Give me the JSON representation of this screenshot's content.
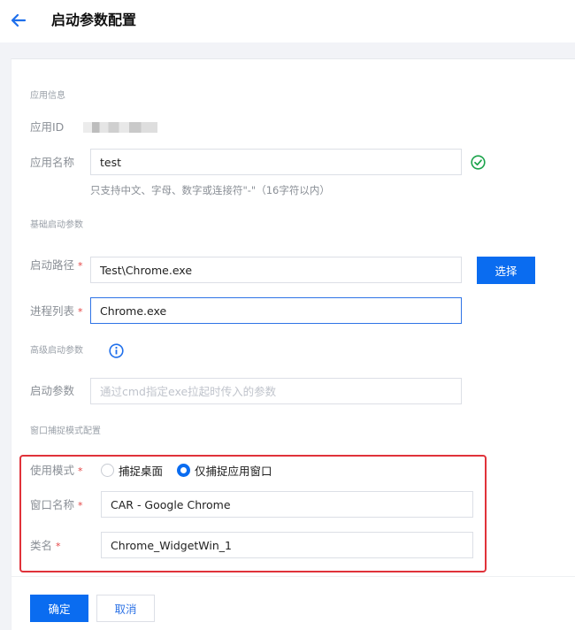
{
  "header": {
    "title": "启动参数配置",
    "back_icon": "arrow-left-icon"
  },
  "app_info": {
    "section_title": "应用信息",
    "app_id_label": "应用ID",
    "app_name_label": "应用名称",
    "app_name_value": "test",
    "app_name_hint": "只支持中文、字母、数字或连接符\"-\"（16字符以内）"
  },
  "basic": {
    "section_title": "基础启动参数",
    "path_label": "启动路径",
    "path_value": "Test\\Chrome.exe",
    "select_button": "选择",
    "process_label": "进程列表",
    "process_value": "Chrome.exe"
  },
  "advanced": {
    "section_title": "高级启动参数",
    "params_label": "启动参数",
    "params_placeholder": "通过cmd指定exe拉起时传入的参数"
  },
  "capture": {
    "section_title": "窗口捕捉模式配置",
    "mode_label": "使用模式",
    "option_desktop": "捕捉桌面",
    "option_app_window": "仅捕捉应用窗口",
    "selected": "option_app_window",
    "window_name_label": "窗口名称",
    "window_name_value": "CAR - Google Chrome",
    "class_label": "类名",
    "class_value": "Chrome_WidgetWin_1"
  },
  "required_mark": "*",
  "footer": {
    "confirm": "确定",
    "cancel": "取消"
  },
  "colors": {
    "primary": "#0a6cf0",
    "success": "#1aa34a",
    "error": "#e0323a"
  }
}
